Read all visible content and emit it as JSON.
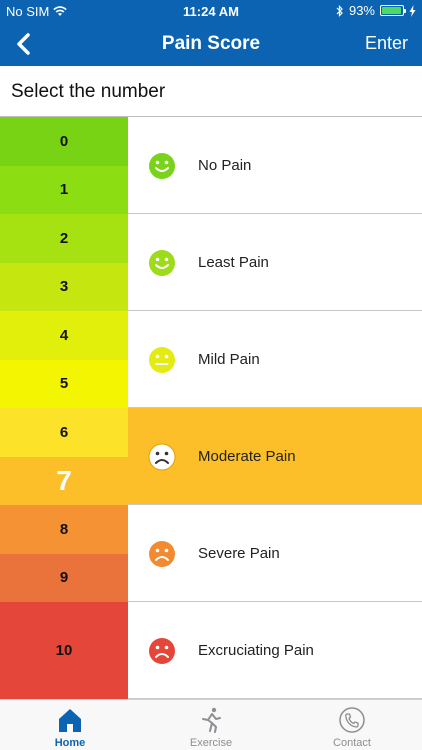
{
  "status_bar": {
    "carrier": "No SIM",
    "time": "11:24 AM",
    "battery": "93%",
    "battery_level": 0.93
  },
  "nav": {
    "title": "Pain Score",
    "enter_label": "Enter"
  },
  "prompt": "Select the number",
  "scale": {
    "selected_value": "7",
    "values": [
      {
        "label": "0",
        "color": "#78d314"
      },
      {
        "label": "1",
        "color": "#8ddd13"
      },
      {
        "label": "2",
        "color": "#a6e211"
      },
      {
        "label": "3",
        "color": "#c5e60e"
      },
      {
        "label": "4",
        "color": "#e1ef0b"
      },
      {
        "label": "5",
        "color": "#f4f500"
      },
      {
        "label": "6",
        "color": "#fde22a"
      },
      {
        "label": "7",
        "color": "#fcbf2a"
      },
      {
        "label": "8",
        "color": "#f59233"
      },
      {
        "label": "9",
        "color": "#e9733a"
      },
      {
        "label": "10",
        "color": "#e4473a"
      }
    ]
  },
  "descriptors": [
    {
      "label": "No Pain",
      "face": "smile-face-icon",
      "color": "#79d31a"
    },
    {
      "label": "Least Pain",
      "face": "smile-face-icon",
      "color": "#9ddb1b"
    },
    {
      "label": "Mild Pain",
      "face": "neutral-face-icon",
      "color": "#e4eb13"
    },
    {
      "label": "Moderate Pain",
      "face": "frown-face-icon",
      "color": "#ffffff"
    },
    {
      "label": "Severe Pain",
      "face": "frown-face-icon",
      "color": "#f28a32"
    },
    {
      "label": "Excruciating Pain",
      "face": "frown-face-icon",
      "color": "#e4473a"
    }
  ],
  "tabs": [
    {
      "label": "Home",
      "icon": "home-icon",
      "active": true
    },
    {
      "label": "Exercise",
      "icon": "runner-icon",
      "active": false
    },
    {
      "label": "Contact",
      "icon": "phone-icon",
      "active": false
    }
  ],
  "colors": {
    "brand": "#0b63b2",
    "active_row": "#fcbf2a"
  }
}
